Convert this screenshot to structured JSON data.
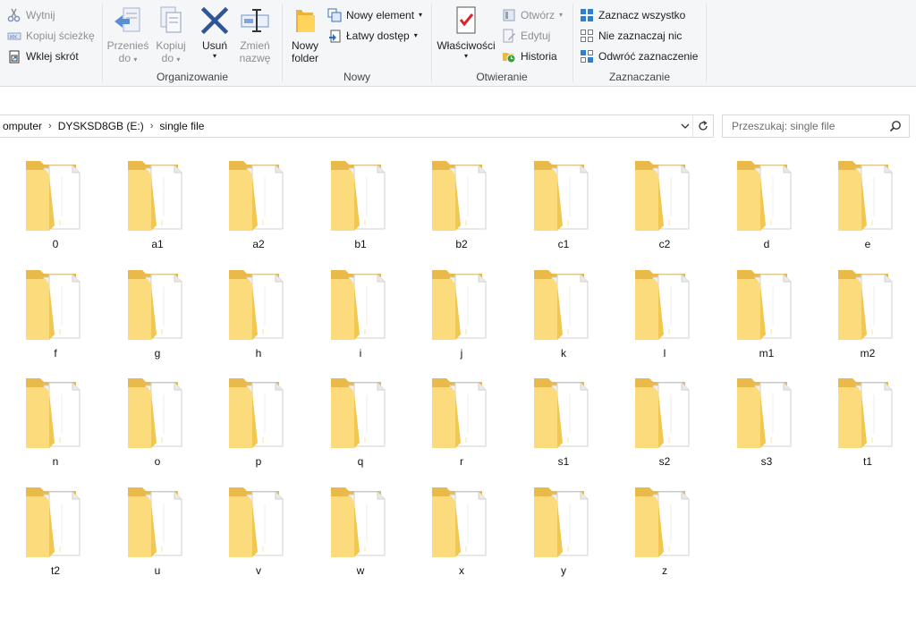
{
  "ribbon": {
    "clipboard": {
      "cut": "Wytnij",
      "copy_path": "Kopiuj ścieżkę",
      "paste_shortcut": "Wklej skrót"
    },
    "organize": {
      "label": "Organizowanie",
      "move_to": [
        "Przenieś",
        "do"
      ],
      "copy_to": [
        "Kopiuj",
        "do"
      ],
      "delete": "Usuń",
      "rename": [
        "Zmień",
        "nazwę"
      ]
    },
    "new": {
      "label": "Nowy",
      "new_folder": [
        "Nowy",
        "folder"
      ],
      "new_item": "Nowy element",
      "easy_access": "Łatwy dostęp"
    },
    "open": {
      "label": "Otwieranie",
      "properties": "Właściwości",
      "open": "Otwórz",
      "edit": "Edytuj",
      "history": "Historia"
    },
    "select": {
      "label": "Zaznaczanie",
      "select_all": "Zaznacz wszystko",
      "select_none": "Nie zaznaczaj nic",
      "invert": "Odwróć zaznaczenie"
    }
  },
  "address": {
    "crumbs": [
      "omputer",
      "DYSKSD8GB (E:)",
      "single file"
    ]
  },
  "search": {
    "placeholder": "Przeszukaj: single file"
  },
  "folders": [
    "0",
    "a1",
    "a2",
    "b1",
    "b2",
    "c1",
    "c2",
    "d",
    "e",
    "f",
    "g",
    "h",
    "i",
    "j",
    "k",
    "l",
    "m1",
    "m2",
    "n",
    "o",
    "p",
    "q",
    "r",
    "s1",
    "s2",
    "s3",
    "t1",
    "t2",
    "u",
    "v",
    "w",
    "x",
    "y",
    "z"
  ],
  "colors": {
    "folder": "#f9d66b",
    "folder_front": "#ffe08a",
    "accent": "#1979ca"
  }
}
